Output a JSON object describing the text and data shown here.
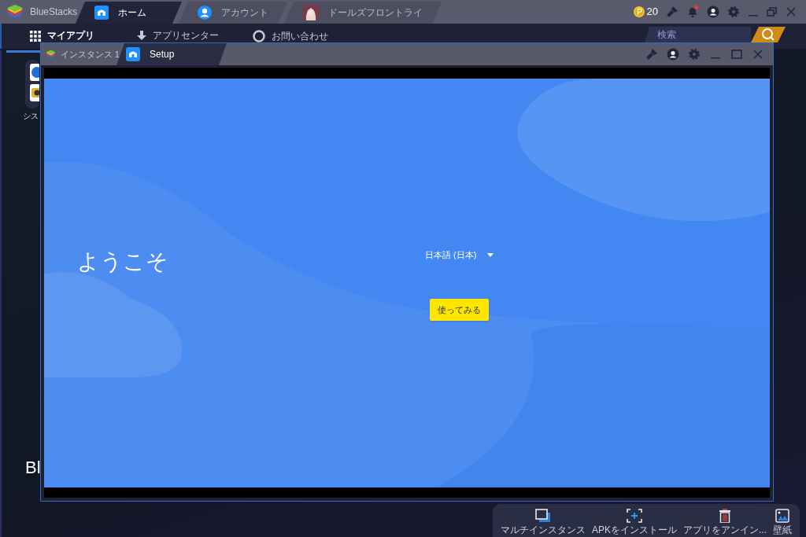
{
  "main_window": {
    "app_name": "BlueStacks",
    "tabs": [
      {
        "label": "ホーム",
        "selected": true,
        "kind": "home"
      },
      {
        "label": "アカウント",
        "selected": false,
        "kind": "account"
      },
      {
        "label": "ドールズフロントライ",
        "selected": false,
        "kind": "game"
      }
    ],
    "coins": "20",
    "notification": true,
    "nav": [
      {
        "label": "マイアプリ",
        "selected": true,
        "kind": "grid"
      },
      {
        "label": "アプリセンター",
        "selected": false,
        "kind": "download"
      },
      {
        "label": "お問い合わせ",
        "selected": false,
        "kind": "support"
      }
    ],
    "search": {
      "placeholder": "検索"
    },
    "app_label": "シス",
    "banner_text": "Bl",
    "toolbar": [
      {
        "label": "マルチインスタンス",
        "kind": "multi"
      },
      {
        "label": "APKをインストール",
        "kind": "apk"
      },
      {
        "label": "アプリをアンイン...",
        "kind": "trash"
      },
      {
        "label": "壁紙",
        "kind": "wallpaper"
      }
    ]
  },
  "instance_window": {
    "name": "インスタンス 1",
    "tabs": [
      {
        "label": "Setup",
        "selected": true
      }
    ],
    "setup": {
      "title": "ようこそ",
      "language": "日本語 (日本)",
      "button": "使ってみる"
    }
  }
}
